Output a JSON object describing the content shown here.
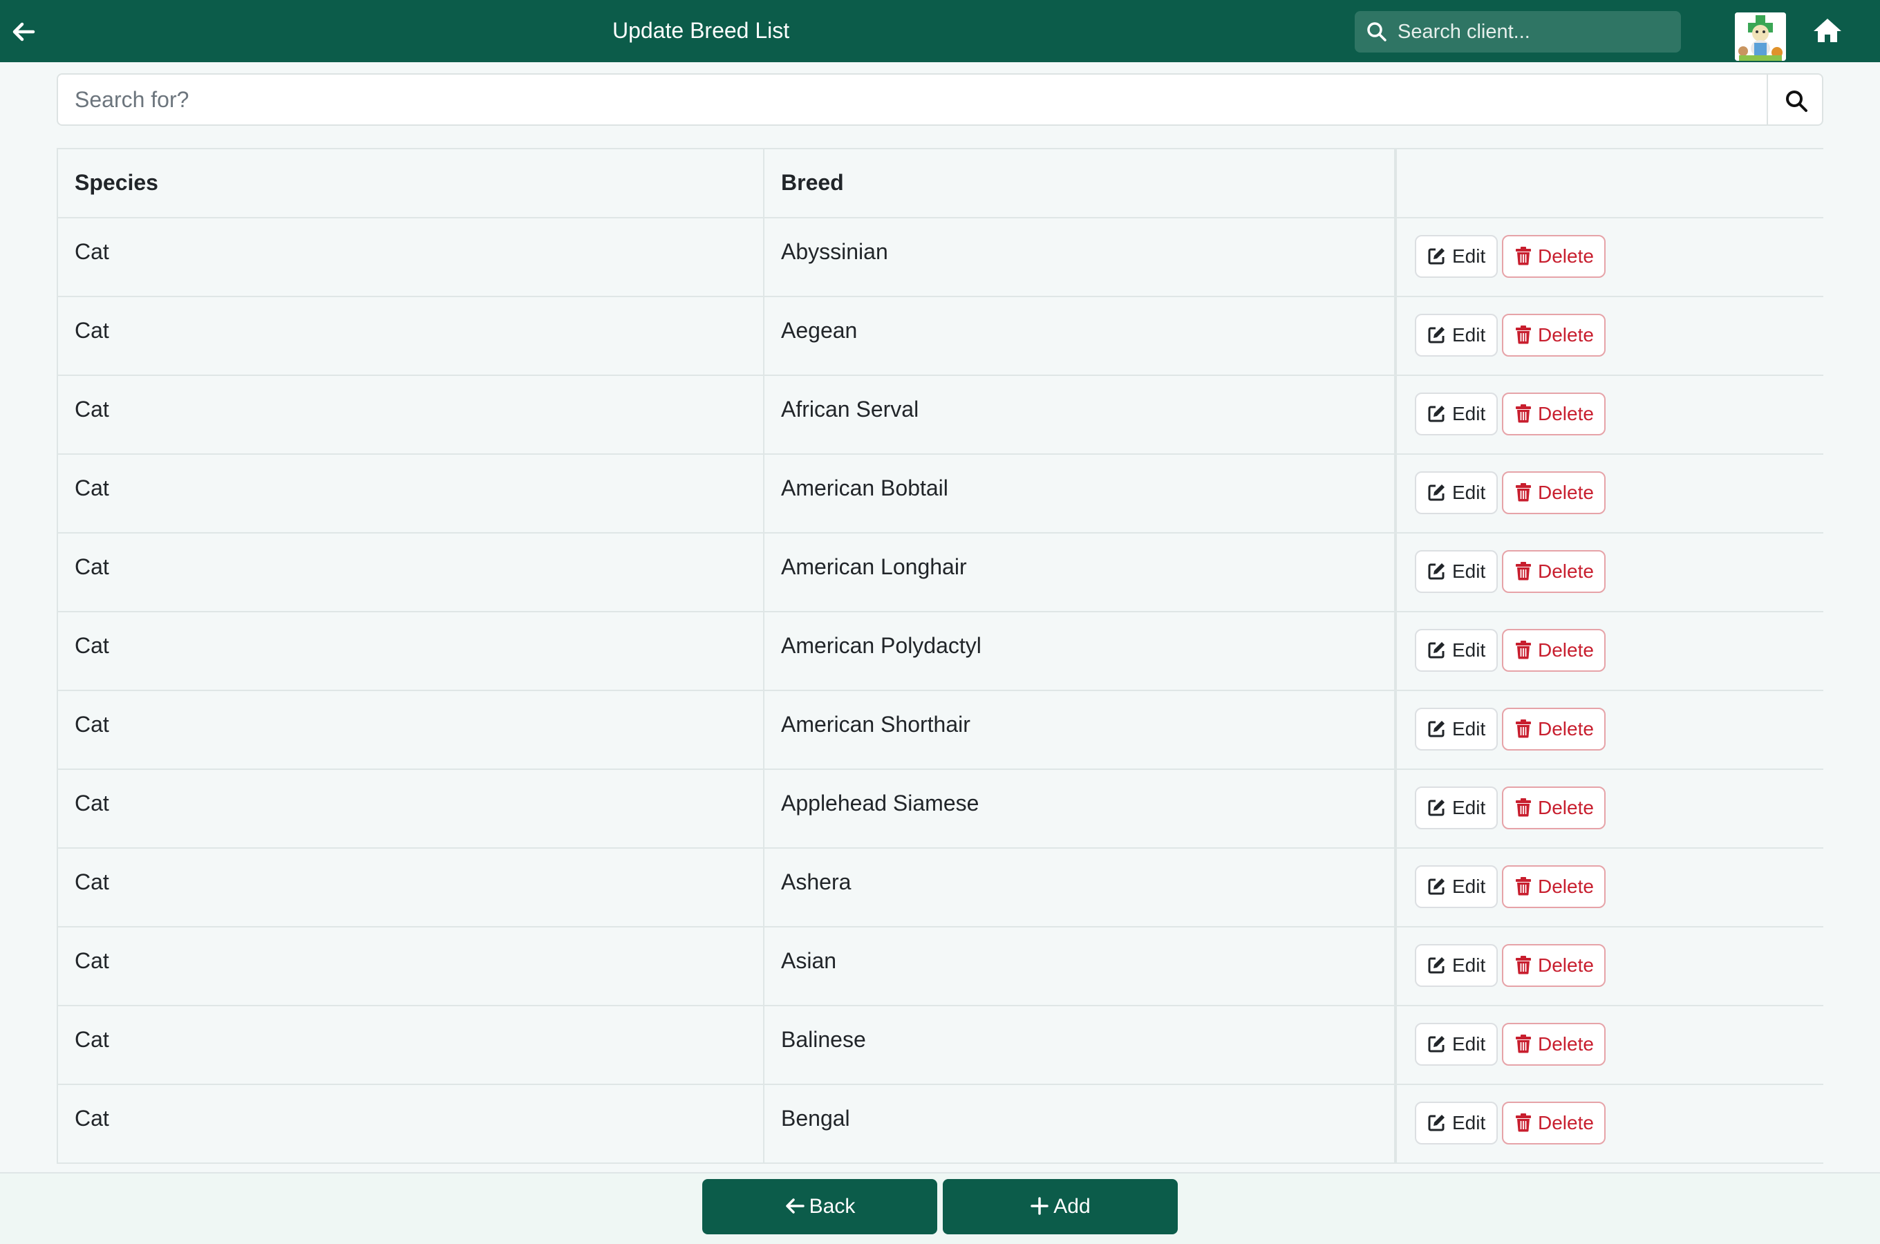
{
  "header": {
    "title": "Update Breed List",
    "client_search_placeholder": "Search client...",
    "back_icon": "arrow-left-icon",
    "home_icon": "home-icon",
    "avatar": "clinic-logo"
  },
  "search": {
    "placeholder": "Search for?",
    "button_icon": "search-icon"
  },
  "table": {
    "columns": [
      "Species",
      "Breed",
      ""
    ],
    "rows": [
      {
        "species": "Cat",
        "breed": "Abyssinian"
      },
      {
        "species": "Cat",
        "breed": "Aegean"
      },
      {
        "species": "Cat",
        "breed": "African Serval"
      },
      {
        "species": "Cat",
        "breed": "American Bobtail"
      },
      {
        "species": "Cat",
        "breed": "American Longhair"
      },
      {
        "species": "Cat",
        "breed": "American Polydactyl"
      },
      {
        "species": "Cat",
        "breed": "American Shorthair"
      },
      {
        "species": "Cat",
        "breed": "Applehead Siamese"
      },
      {
        "species": "Cat",
        "breed": "Ashera"
      },
      {
        "species": "Cat",
        "breed": "Asian"
      },
      {
        "species": "Cat",
        "breed": "Balinese"
      },
      {
        "species": "Cat",
        "breed": "Bengal"
      }
    ],
    "edit_label": "Edit",
    "delete_label": "Delete"
  },
  "footer": {
    "back_label": "Back",
    "add_label": "Add"
  },
  "colors": {
    "brand": "#0c5c4a",
    "danger": "#c81e2e",
    "background": "#f4f8f8"
  }
}
